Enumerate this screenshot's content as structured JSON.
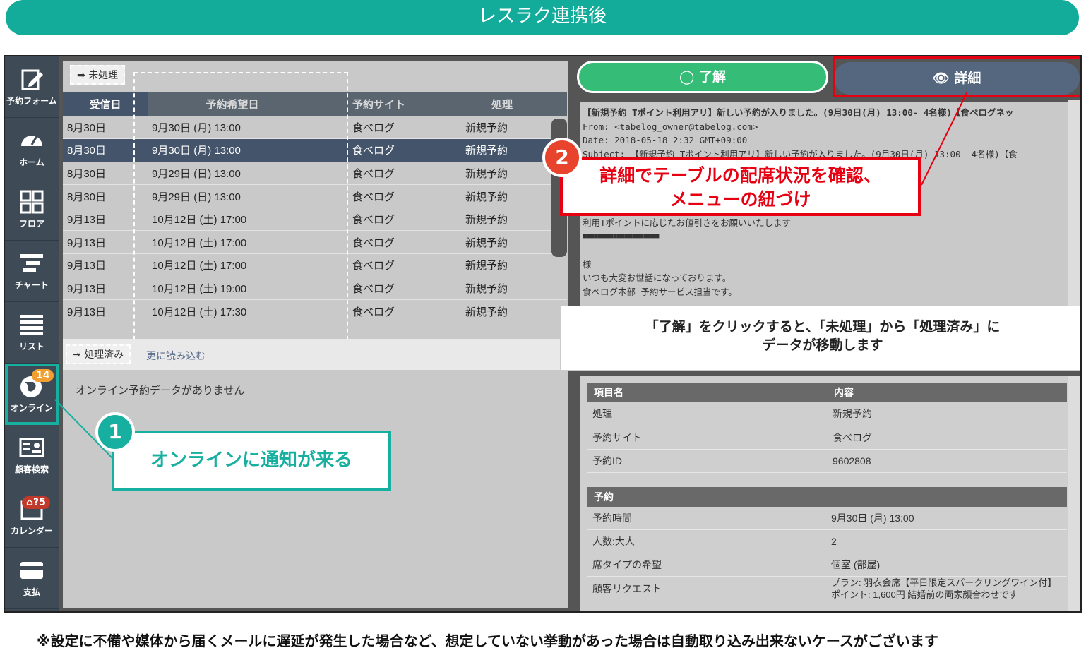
{
  "banner": "レスラク連携後",
  "sidebar": [
    {
      "label": "予約フォーム",
      "icon": "edit-form-icon"
    },
    {
      "label": "ホーム",
      "icon": "dashboard-icon"
    },
    {
      "label": "フロア",
      "icon": "floor-grid-icon"
    },
    {
      "label": "チャート",
      "icon": "chart-bars-icon"
    },
    {
      "label": "リスト",
      "icon": "list-icon"
    },
    {
      "label": "オンライン",
      "icon": "globe-icon",
      "badge": "14"
    },
    {
      "label": "顧客検索",
      "icon": "id-card-icon"
    },
    {
      "label": "カレンダー",
      "icon": "calendar-icon",
      "badge": "5"
    },
    {
      "label": "支払",
      "icon": "card-icon"
    }
  ],
  "unprocessed": {
    "tag": "未処理",
    "headers": [
      "受信日",
      "予約希望日",
      "予約サイト",
      "処理"
    ],
    "rows": [
      [
        "8月30日",
        "9月30日 (月) 13:00",
        "食べログ",
        "新規予約"
      ],
      [
        "8月30日",
        "9月30日 (月) 13:00",
        "食べログ",
        "新規予約"
      ],
      [
        "8月30日",
        "9月29日 (日) 13:00",
        "食べログ",
        "新規予約"
      ],
      [
        "8月30日",
        "9月29日 (日) 13:00",
        "食べログ",
        "新規予約"
      ],
      [
        "9月13日",
        "10月12日 (土) 17:00",
        "食べログ",
        "新規予約"
      ],
      [
        "9月13日",
        "10月12日 (土) 17:00",
        "食べログ",
        "新規予約"
      ],
      [
        "9月13日",
        "10月12日 (土) 17:00",
        "食べログ",
        "新規予約"
      ],
      [
        "9月13日",
        "10月12日 (土) 19:00",
        "食べログ",
        "新規予約"
      ],
      [
        "9月13日",
        "10月12日 (土) 17:30",
        "食べログ",
        "新規予約"
      ]
    ]
  },
  "processed": {
    "tag": "処理済み",
    "read_more": "更に読み込む",
    "empty": "オンライン予約データがありません"
  },
  "actions": {
    "ok": "了解",
    "detail": "詳細"
  },
  "mail": {
    "lines": [
      "【新規予約 Tポイント利用アリ】新しい予約が入りました。(9月30日(月) 13:00- 4名様)【食べログネッ",
      "From: <tabelog_owner@tabelog.com>",
      "Date: 2018-05-18 2:32 GMT+09:00",
      "Subject: 【新規予約 Tポイント利用アリ】新しい予約が入りました。(9月30日(月) 13:00- 4名様)【食",
      "",
      "",
      "",
      "",
      "利用Tポイントに応じたお値引きをお願いいたします",
      "■■■■■■■■■■■■■■■■■■■■",
      "",
      "様",
      "いつも大変お世話になっております。",
      "食べログ本部 予約サービス担当です。"
    ]
  },
  "detail_table": {
    "header_item": "項目名",
    "header_content": "内容",
    "rows": [
      [
        "処理",
        "新規予約"
      ],
      [
        "予約サイト",
        "食べログ"
      ],
      [
        "予約ID",
        "9602808"
      ]
    ],
    "section": "予約",
    "rows2": [
      [
        "予約時間",
        "9月30日 (月) 13:00"
      ],
      [
        "人数:大人",
        "2"
      ],
      [
        "席タイプの希望",
        "個室 (部屋)"
      ],
      [
        "顧客リクエスト",
        "プラン: 羽衣会席【平日限定スパークリングワイン付】 ポイント: 1,600円 結婚前の両家顔合わせです"
      ]
    ]
  },
  "callouts": {
    "one_num": "1",
    "one_text": "オンラインに通知が来る",
    "two_num": "2",
    "two_line1": "詳細でテーブルの配席状況を確認、",
    "two_line2": "メニューの紐づけ",
    "grey_line1": "「了解」をクリックすると、「未処理」から「処理済み」に",
    "grey_line2": "データが移動します"
  },
  "footer": "※設定に不備や媒体から届くメールに遅延が発生した場合など、想定していない挙動があった場合は自動取り込み出来ないケースがございます",
  "colors": {
    "teal": "#13ab9a",
    "red": "#e60012",
    "navy": "#44546a",
    "green": "#35bd77"
  }
}
